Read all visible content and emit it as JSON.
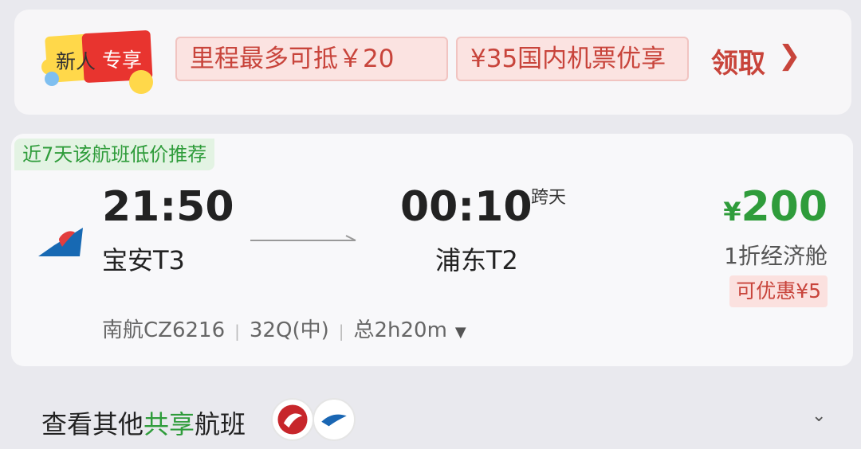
{
  "promo": {
    "badge_left": "新人",
    "badge_right": "专享",
    "coupons": [
      "里程最多可抵￥20",
      "¥35国内机票优享"
    ],
    "claim_label": "领取"
  },
  "flight": {
    "tag": "近7天该航班低价推荐",
    "departure": {
      "time": "21:50",
      "airport": "宝安T3"
    },
    "arrival": {
      "time": "00:10",
      "airport": "浦东T2",
      "note": "跨天"
    },
    "price": {
      "symbol": "¥",
      "value": "200"
    },
    "cabin": "1折经济舱",
    "discount": "可优惠¥5",
    "flight_no": "南航CZ6216",
    "aircraft": "32Q(中)",
    "duration": "总2h20m"
  },
  "share": {
    "label_prefix": "查看其他",
    "label_highlight": "共享",
    "label_suffix": "航班"
  },
  "colors": {
    "accent_green": "#2f9c3b",
    "accent_red": "#c8443b"
  },
  "icons": [
    "china-southern-logo-icon",
    "arrow-right-icon",
    "chevron-down-icon",
    "sichuan-airlines-logo-icon",
    "xiamen-airlines-logo-icon"
  ]
}
